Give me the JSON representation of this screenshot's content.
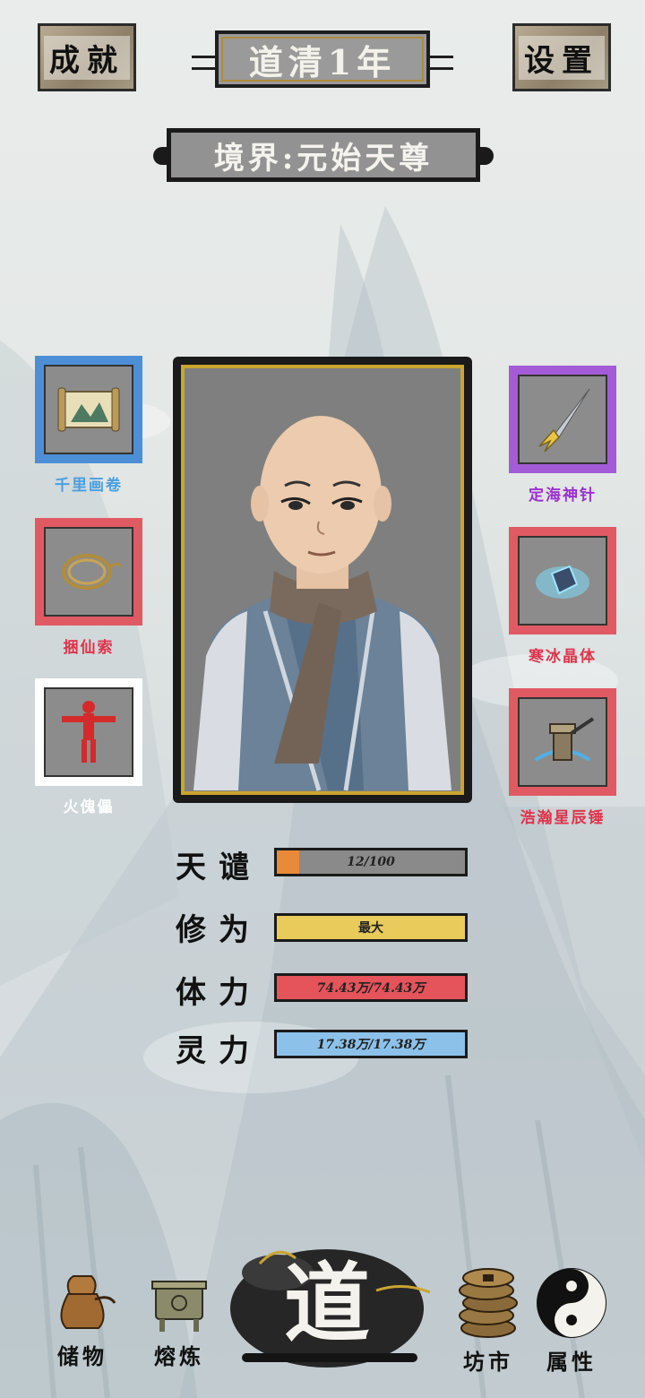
{
  "header": {
    "achievements_label": "成就",
    "settings_label": "设置",
    "year_label": "道清1年",
    "realm_label": "境界:元始天尊"
  },
  "equipment": {
    "left": [
      {
        "name": "千里画卷",
        "rarity_color": "#4a9fe0",
        "frame_color": "#4d8fd6"
      },
      {
        "name": "捆仙索",
        "rarity_color": "#e0334a",
        "frame_color": "#e05a63"
      },
      {
        "name": "火傀儡",
        "rarity_color": "#ffffff",
        "frame_color": "#ffffff"
      }
    ],
    "right": [
      {
        "name": "定海神针",
        "rarity_color": "#9b2fd1",
        "frame_color": "#a45bd8"
      },
      {
        "name": "寒冰晶体",
        "rarity_color": "#e0334a",
        "frame_color": "#e05a63"
      },
      {
        "name": "浩瀚星辰锤",
        "rarity_color": "#e0334a",
        "frame_color": "#e05a63"
      }
    ]
  },
  "stats": [
    {
      "name": "天谴",
      "value": "12/100",
      "fill": 0.12,
      "fill_color": "#e98a3a",
      "track_color": "#8a8a8a"
    },
    {
      "name": "修为",
      "value": "最大",
      "fill": 1.0,
      "fill_color": "#e8cb5a",
      "track_color": "#e8cb5a"
    },
    {
      "name": "体力",
      "value": "74.43万/74.43万",
      "fill": 1.0,
      "fill_color": "#e5535b",
      "track_color": "#e5535b"
    },
    {
      "name": "灵力",
      "value": "17.38万/17.38万",
      "fill": 1.0,
      "fill_color": "#8cc2ea",
      "track_color": "#8cc2ea"
    }
  ],
  "nav": {
    "storage": "储物",
    "refine": "熔炼",
    "center": "道",
    "market": "坊市",
    "attributes": "属性"
  }
}
